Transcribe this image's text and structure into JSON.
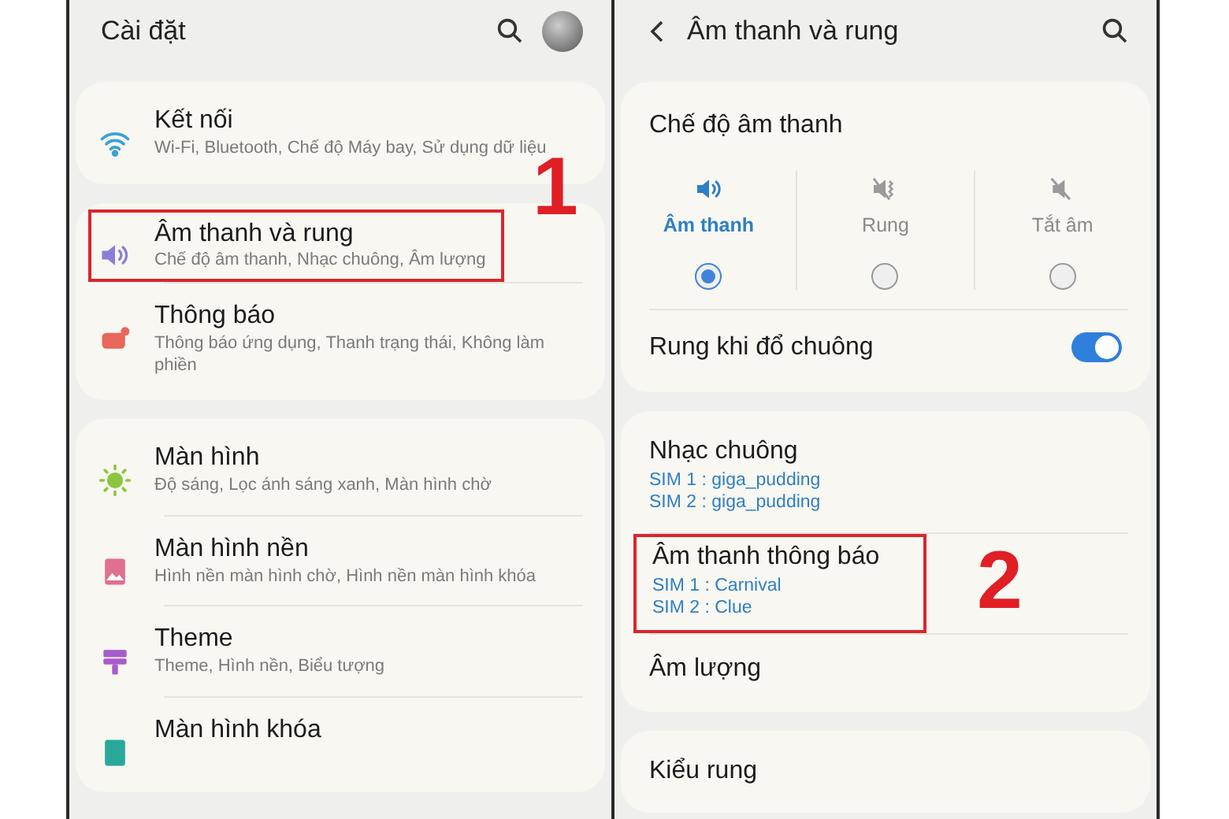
{
  "left_screen": {
    "title": "Cài đặt",
    "groups": [
      {
        "items": [
          {
            "title": "Kết nối",
            "subtitle": "Wi-Fi, Bluetooth, Chế độ Máy bay, Sử dụng dữ liệu",
            "highlighted": false
          }
        ]
      },
      {
        "items": [
          {
            "title": "Âm thanh và rung",
            "subtitle": "Chế độ âm thanh, Nhạc chuông, Âm lượng",
            "highlighted": true,
            "marker": "1"
          },
          {
            "title": "Thông báo",
            "subtitle": "Thông báo ứng dụng, Thanh trạng thái, Không làm phiền",
            "highlighted": false
          }
        ]
      },
      {
        "items": [
          {
            "title": "Màn hình",
            "subtitle": "Độ sáng, Lọc ánh sáng xanh, Màn hình chờ",
            "highlighted": false
          },
          {
            "title": "Màn hình nền",
            "subtitle": "Hình nền màn hình chờ, Hình nền màn hình khóa",
            "highlighted": false
          },
          {
            "title": "Theme",
            "subtitle": "Theme, Hình nền, Biểu tượng",
            "highlighted": false
          },
          {
            "title": "Màn hình khóa",
            "highlighted": false
          }
        ]
      }
    ]
  },
  "right_screen": {
    "title": "Âm thanh và rung",
    "sound_mode": {
      "heading": "Chế độ âm thanh",
      "options": [
        {
          "label": "Âm thanh",
          "selected": true
        },
        {
          "label": "Rung",
          "selected": false
        },
        {
          "label": "Tắt âm",
          "selected": false
        }
      ]
    },
    "toggle": {
      "label": "Rung khi đổ chuông",
      "on": true
    },
    "groups": [
      {
        "items": [
          {
            "title": "Nhạc chuông",
            "details": [
              "SIM 1 : giga_pudding",
              "SIM 2 : giga_pudding"
            ],
            "highlighted": false
          },
          {
            "title": "Âm thanh thông báo",
            "details": [
              "SIM 1 : Carnival",
              "SIM 2 : Clue"
            ],
            "highlighted": true,
            "marker": "2"
          },
          {
            "title": "Âm lượng",
            "highlighted": false
          }
        ]
      },
      {
        "items": [
          {
            "title": "Kiểu rung",
            "highlighted": false
          }
        ]
      }
    ]
  }
}
